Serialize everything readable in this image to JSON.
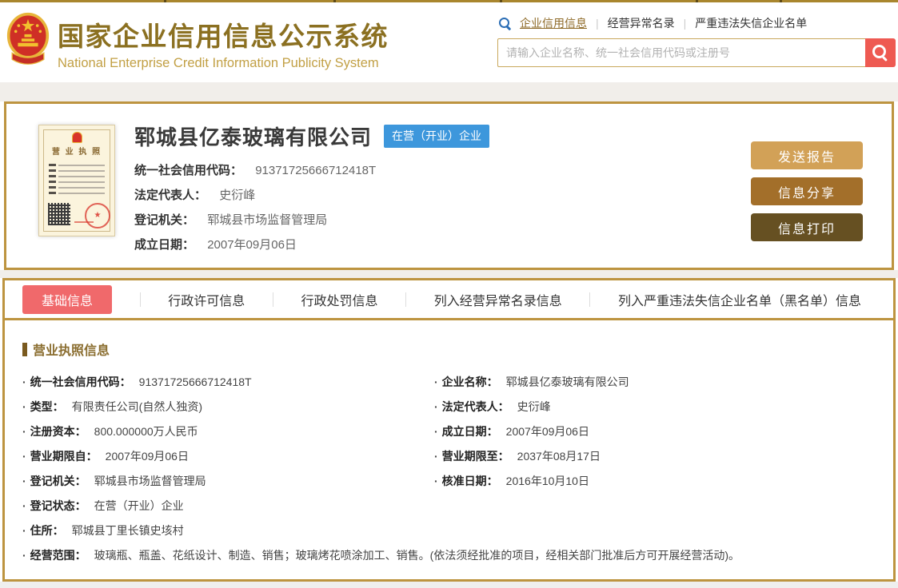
{
  "colors": {
    "accent_gold": "#bd9440",
    "title_gold": "#8b7021",
    "subtitle_gold": "#c2a045",
    "search_button_red": "#ee5a52",
    "status_badge_blue": "#3d97dc",
    "active_tab_red": "#f0696b",
    "button_send_report": "#d2a157",
    "button_share_info": "#a36f2a",
    "button_print_info": "#665022"
  },
  "header": {
    "title_cn": "国家企业信用信息公示系统",
    "title_en": "National Enterprise Credit Information Publicity System",
    "nav": [
      {
        "label": "企业信用信息"
      },
      {
        "label": "经营异常名录"
      },
      {
        "label": "严重违法失信企业名单"
      }
    ],
    "search_placeholder": "请输入企业名称、统一社会信用代码或注册号",
    "icons": {
      "nav_search": "magnifier-icon-blue",
      "search_button": "magnifier-icon-white"
    }
  },
  "company_card": {
    "name": "郓城县亿泰玻璃有限公司",
    "status_badge": "在营（开业）企业",
    "license_thumb_title": "营 业 执 照",
    "fields": [
      {
        "label": "统一社会信用代码：",
        "value": "91371725666712418T"
      },
      {
        "label": "法定代表人：",
        "value": "史衍峰"
      },
      {
        "label": "登记机关：",
        "value": "郓城县市场监督管理局"
      },
      {
        "label": "成立日期：",
        "value": "2007年09月06日"
      }
    ],
    "buttons": [
      {
        "label": "发送报告"
      },
      {
        "label": "信息分享"
      },
      {
        "label": "信息打印"
      }
    ]
  },
  "tabs": [
    {
      "label": "基础信息",
      "active": true
    },
    {
      "label": "行政许可信息",
      "active": false
    },
    {
      "label": "行政处罚信息",
      "active": false
    },
    {
      "label": "列入经营异常名录信息",
      "active": false
    },
    {
      "label": "列入严重违法失信企业名单（黑名单）信息",
      "active": false
    }
  ],
  "license_section": {
    "title": "营业执照信息",
    "fields": [
      {
        "label": "统一社会信用代码：",
        "value": "91371725666712418T"
      },
      {
        "label": "企业名称：",
        "value": "郓城县亿泰玻璃有限公司"
      },
      {
        "label": "类型：",
        "value": "有限责任公司(自然人独资)"
      },
      {
        "label": "法定代表人：",
        "value": "史衍峰"
      },
      {
        "label": "注册资本：",
        "value": "800.000000万人民币"
      },
      {
        "label": "成立日期：",
        "value": "2007年09月06日"
      },
      {
        "label": "营业期限自：",
        "value": "2007年09月06日"
      },
      {
        "label": "营业期限至：",
        "value": "2037年08月17日"
      },
      {
        "label": "登记机关：",
        "value": "郓城县市场监督管理局"
      },
      {
        "label": "核准日期：",
        "value": "2016年10月10日"
      },
      {
        "label": "登记状态：",
        "value": "在营（开业）企业"
      },
      {
        "label": "住所：",
        "value": "郓城县丁里长镇史垓村"
      },
      {
        "label": "经营范围：",
        "value": "玻璃瓶、瓶盖、花纸设计、制造、销售；玻璃烤花喷涂加工、销售。(依法须经批准的项目，经相关部门批准后方可开展经营活动)。"
      }
    ]
  }
}
